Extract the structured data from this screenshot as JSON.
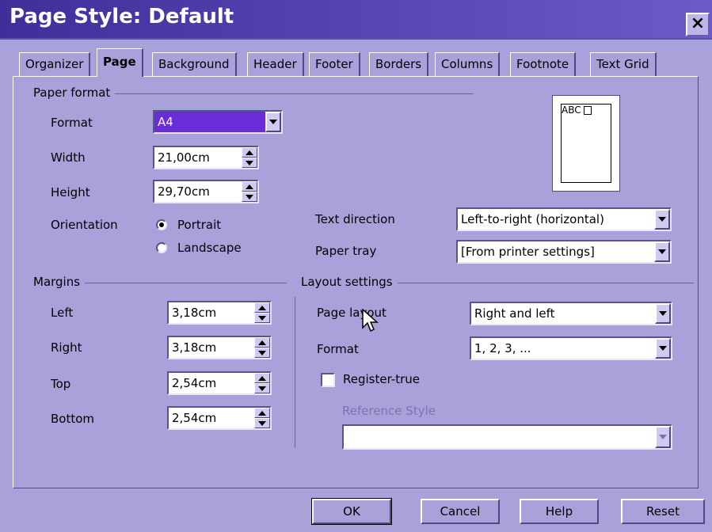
{
  "window": {
    "title": "Page Style: Default",
    "close_label": "×"
  },
  "tabs": [
    {
      "label": "Organizer"
    },
    {
      "label": "Page"
    },
    {
      "label": "Background"
    },
    {
      "label": "Header"
    },
    {
      "label": "Footer"
    },
    {
      "label": "Borders"
    },
    {
      "label": "Columns"
    },
    {
      "label": "Footnote"
    },
    {
      "label": "Text Grid"
    }
  ],
  "paper_format": {
    "group_label": "Paper format",
    "format_label": "Format",
    "format_value": "A4",
    "width_label": "Width",
    "width_value": "21,00cm",
    "height_label": "Height",
    "height_value": "29,70cm",
    "orientation_label": "Orientation",
    "portrait_label": "Portrait",
    "landscape_label": "Landscape",
    "orientation_selected": "Portrait",
    "text_direction_label": "Text direction",
    "text_direction_value": "Left-to-right (horizontal)",
    "paper_tray_label": "Paper tray",
    "paper_tray_value": "[From printer settings]"
  },
  "preview": {
    "text": "ABC"
  },
  "margins": {
    "group_label": "Margins",
    "left_label": "Left",
    "left_value": "3,18cm",
    "right_label": "Right",
    "right_value": "3,18cm",
    "top_label": "Top",
    "top_value": "2,54cm",
    "bottom_label": "Bottom",
    "bottom_value": "2,54cm"
  },
  "layout": {
    "group_label": "Layout settings",
    "page_layout_label": "Page layout",
    "page_layout_value": "Right and left",
    "format_label": "Format",
    "format_value": "1, 2, 3, ...",
    "register_true_label": "Register-true",
    "register_true_checked": false,
    "reference_style_label": "Reference Style",
    "reference_style_value": ""
  },
  "buttons": {
    "ok": "OK",
    "cancel": "Cancel",
    "help": "Help",
    "reset": "Reset"
  }
}
